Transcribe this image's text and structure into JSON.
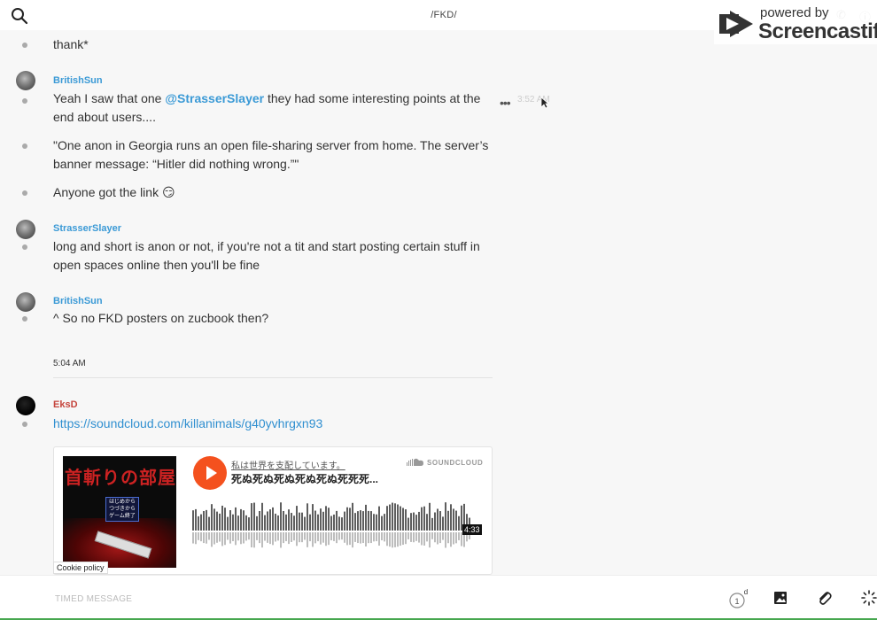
{
  "header": {
    "channel": "/FKD/",
    "search_icon": "search-icon"
  },
  "watermark": {
    "small": "powered by",
    "big": "Screencastify"
  },
  "messages": [
    {
      "text": "thank*"
    },
    {
      "user": "BritishSun",
      "text_parts": [
        "Yeah I saw that one ",
        "@StrasserSlayer",
        " they had some interesting points at the end about users...."
      ],
      "time": "3:52 AM",
      "actions": "•••"
    },
    {
      "text": "\"One anon in Georgia runs an open file-sharing server from home. The server’s banner message: “Hitler did nothing wrong.”\""
    },
    {
      "text": "Anyone got the link 😏"
    },
    {
      "user": "StrasserSlayer",
      "text": "long and short is anon or not, if you're not a tit and start posting certain stuff in open spaces online then you'll be fine"
    },
    {
      "user": "BritishSun",
      "text": "^ So no FKD posters on zucbook then?"
    },
    {
      "user": "EksD",
      "link": "https://soundcloud.com/killanimals/g40yvhrgxn93"
    }
  ],
  "day_separator": "5:04 AM",
  "embed": {
    "artist": "私は世界を支配しています。",
    "track": "死ぬ死ぬ死ぬ死ぬ死ぬ死死死...",
    "brand": "SOUNDCLOUD",
    "duration": "4:33",
    "art_title": "首斬りの部屋",
    "art_menu": [
      "はじめから",
      "つづきから",
      "ゲーム終了"
    ]
  },
  "cookie_policy": "Cookie policy",
  "composer": {
    "placeholder": "TIMED MESSAGE",
    "timer_value": "1",
    "timer_unit": "d"
  },
  "colors": {
    "accent": "#3b9ad6",
    "eksd": "#c5443c",
    "soundcloud": "#f4511e"
  }
}
